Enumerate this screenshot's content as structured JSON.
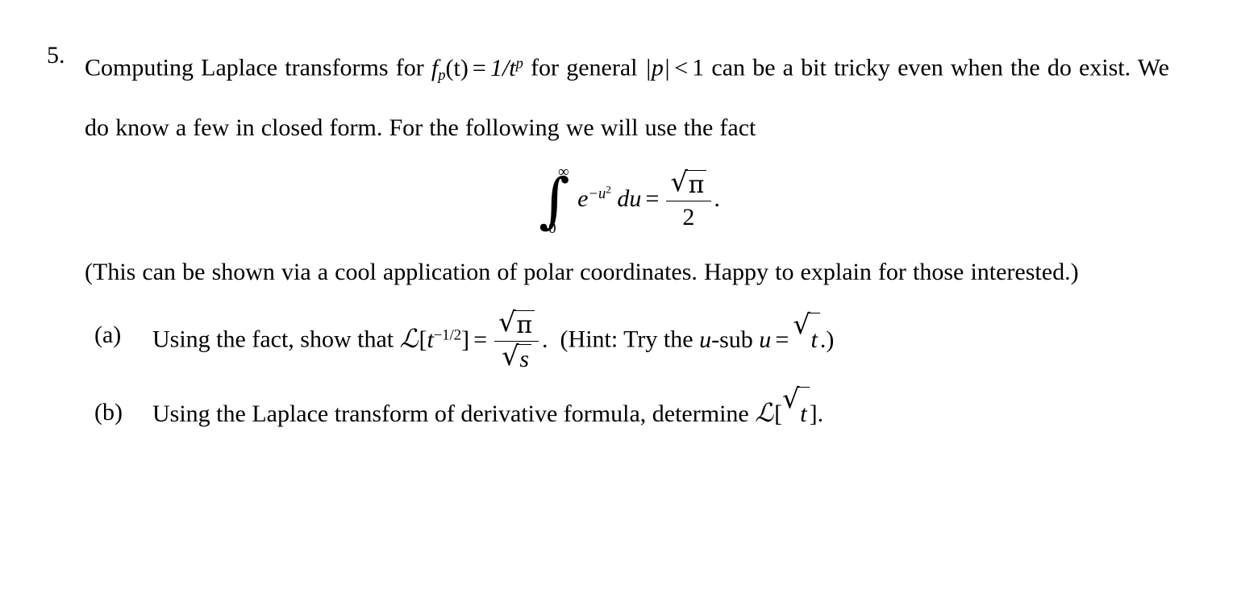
{
  "document": {
    "problem_number": "5.",
    "intro": {
      "text_before_math": "Computing Laplace transforms for",
      "func_f": "f",
      "func_sub": "p",
      "func_arg": "(t)",
      "equals": "=",
      "one_over": "1/t",
      "exp_p": "p",
      "text_middle": "for general",
      "abs_p": "|p|",
      "less_than": "<",
      "one": "1",
      "text_after": "can be a bit tricky even when the do exist. We do know a few in closed form. For the following we will use the fact"
    },
    "display_equation": {
      "integral_symbol": "∫",
      "upper_limit": "∞",
      "lower_limit": "0",
      "integrand_e": "e",
      "integrand_exp": "−u",
      "integrand_exp_power": "2",
      "differential": "du",
      "equals": "=",
      "numerator_radical": "√",
      "numerator_value": "π",
      "denominator": "2",
      "trailing_punctuation": "."
    },
    "note": "(This can be shown via a cool application of polar coordinates. Happy to explain for those interested.)",
    "subitems": [
      {
        "label": "(a)",
        "text_before": "Using the fact, show that",
        "laplace_symbol": "ℒ",
        "bracket_open": "[",
        "arg_base": "t",
        "arg_exponent": "−1/2",
        "bracket_close": "]",
        "equals": "=",
        "frac_num_radical": "√",
        "frac_num_value": "π",
        "frac_den_radical": "√",
        "frac_den_value": "s",
        "period": ".",
        "hint_open": "(Hint: Try the",
        "hint_u": "u",
        "hint_sub": "-sub",
        "hint_u2": "u",
        "hint_equals": "=",
        "hint_radical": "√",
        "hint_radicand": "t",
        "hint_close": ".)"
      },
      {
        "label": "(b)",
        "text_before": "Using the Laplace transform of derivative formula, determine",
        "laplace_symbol": "ℒ",
        "bracket_open": "[",
        "arg_radical": "√",
        "arg_radicand": "t",
        "bracket_close": "]",
        "period": "."
      }
    ]
  },
  "colors": {
    "background": "#ffffff",
    "text": "#000000"
  }
}
